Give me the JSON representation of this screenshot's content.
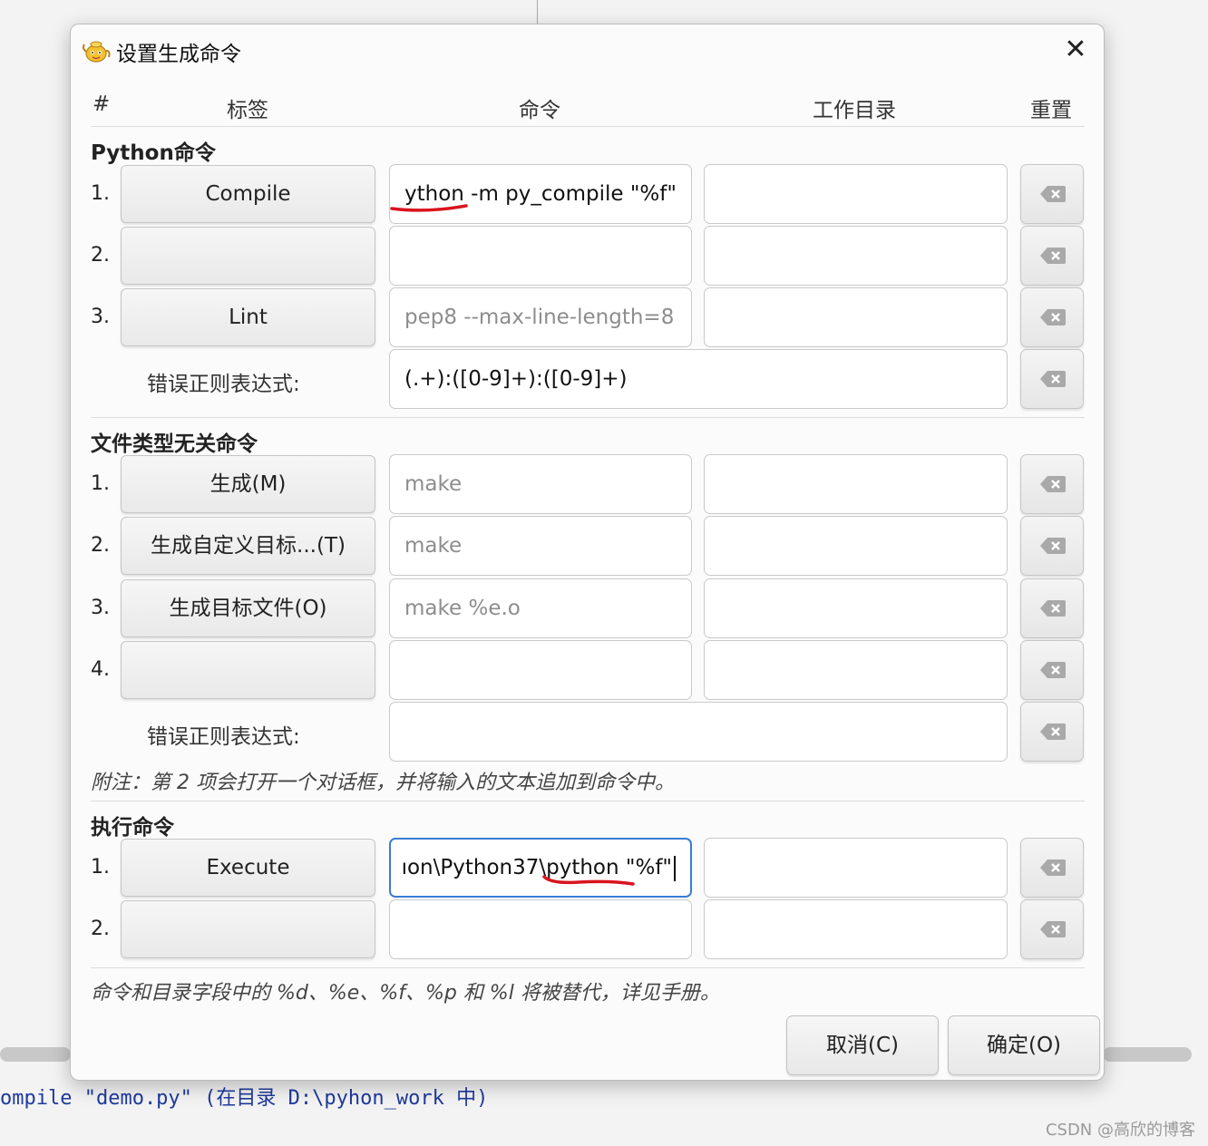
{
  "dialog": {
    "title": "设置生成命令",
    "app_icon": "geany-teapot-icon",
    "close_label": "✕"
  },
  "headers": {
    "num": "#",
    "label": "标签",
    "command": "命令",
    "workdir": "工作目录",
    "reset": "重置"
  },
  "python_section": {
    "title": "Python命令",
    "rows": [
      {
        "num": "1.",
        "label": "Compile",
        "command": "ython -m py_compile \"%f\"",
        "command_is_placeholder": false,
        "workdir": ""
      },
      {
        "num": "2.",
        "label": "",
        "command": "",
        "workdir": ""
      },
      {
        "num": "3.",
        "label": "Lint",
        "command": "pep8 --max-line-length=8",
        "command_is_placeholder": true,
        "workdir": ""
      }
    ],
    "regex_label": "错误正则表达式:",
    "regex_value": "(.+):([0-9]+):([0-9]+)"
  },
  "independent_section": {
    "title": "文件类型无关命令",
    "rows": [
      {
        "num": "1.",
        "label": "生成(M)",
        "command": "make",
        "command_is_placeholder": true,
        "workdir": ""
      },
      {
        "num": "2.",
        "label": "生成自定义目标...(T)",
        "command": "make",
        "command_is_placeholder": true,
        "workdir": ""
      },
      {
        "num": "3.",
        "label": "生成目标文件(O)",
        "command": "make %e.o",
        "command_is_placeholder": true,
        "workdir": ""
      },
      {
        "num": "4.",
        "label": "",
        "command": "",
        "workdir": ""
      }
    ],
    "regex_label": "错误正则表达式:",
    "regex_value": "",
    "note": "附注：第 2 项会打开一个对话框，并将输入的文本追加到命令中。"
  },
  "execute_section": {
    "title": "执行命令",
    "rows": [
      {
        "num": "1.",
        "label": "Execute",
        "command": "ıon\\Python37\\python \"%f\"",
        "workdir": ""
      },
      {
        "num": "2.",
        "label": "",
        "command": "",
        "workdir": ""
      }
    ]
  },
  "footer_note": "命令和目录字段中的 %d、%e、%f、%p 和 %l 将被替代，详见手册。",
  "buttons": {
    "cancel": "取消(C)",
    "ok": "确定(O)"
  },
  "background": {
    "log_line": "ompile \"demo.py\" (在目录 D:\\pyhon_work 中)",
    "watermark": "CSDN @高欣的博客"
  },
  "colors": {
    "focus_border": "#3a7bd5",
    "annotation_red": "#d9141e",
    "log_text": "#1f3a9c"
  }
}
